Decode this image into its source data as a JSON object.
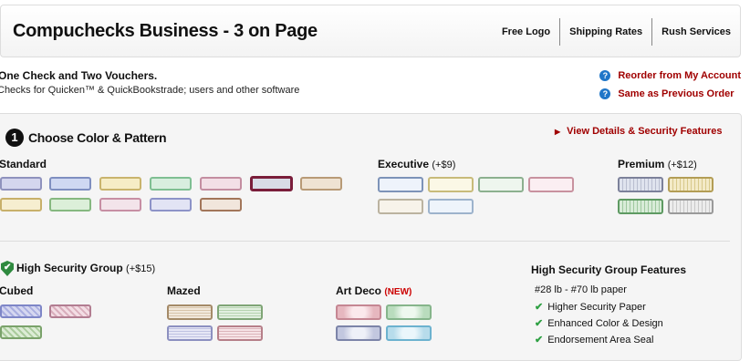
{
  "header": {
    "title": "Compuchecks Business - 3 on Page",
    "links": [
      "Free Logo",
      "Shipping Rates",
      "Rush Services"
    ]
  },
  "subtitle": {
    "line1": "One Check and Two Vouchers.",
    "line2": "Checks for Quicken™ & QuickBookstrade; users and other software"
  },
  "side_links": [
    "Reorder from My Account",
    "Same as Previous Order"
  ],
  "help_icon": "?",
  "step": {
    "number": "1",
    "title": "Choose Color & Pattern",
    "details_link": "View Details & Security Features",
    "details_arrow": "▶"
  },
  "groups": {
    "standard": {
      "name": "Standard",
      "price": ""
    },
    "executive": {
      "name": "Executive",
      "price": "(+$9)"
    },
    "premium": {
      "name": "Premium",
      "price": "(+$12)"
    }
  },
  "high_security": {
    "name": "High Security Group",
    "price": "(+$15)",
    "cubed": "Cubed",
    "mazed": "Mazed",
    "art_deco": "Art Deco",
    "art_deco_badge": "(NEW)"
  },
  "features": {
    "title": "High Security Group Features",
    "paper": "#28 lb - #70 lb paper",
    "items": [
      "Higher Security Paper",
      "Enhanced Color & Design",
      "Endorsement Area Seal"
    ],
    "check_glyph": "✔"
  },
  "colors": {
    "accent_red": "#a00000",
    "help_blue": "#1f76c8",
    "check_green": "#2ea043",
    "selected_border": "#7a1d3a"
  }
}
